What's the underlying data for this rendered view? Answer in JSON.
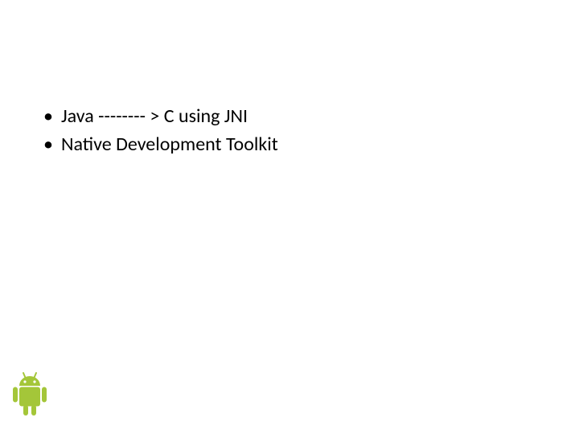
{
  "bullets": {
    "item1": "Java -------- > C using JNI",
    "item2": "Native Development Toolkit"
  },
  "icon": {
    "name": "android-logo",
    "color": "#a4c639"
  }
}
